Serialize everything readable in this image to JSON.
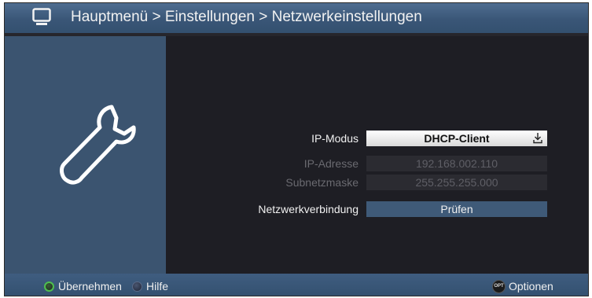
{
  "header": {
    "breadcrumb": "Hauptmenü > Einstellungen > Netzwerkeinstellungen"
  },
  "form": {
    "ip_mode_label": "IP-Modus",
    "ip_mode_value": "DHCP-Client",
    "ip_address_label": "IP-Adresse",
    "ip_address_value": "192.168.002.110",
    "subnet_label": "Subnetzmaske",
    "subnet_value": "255.255.255.000",
    "connection_label": "Netzwerkverbindung",
    "connection_button": "Prüfen"
  },
  "footer": {
    "green_label": "Übernehmen",
    "blue_label": "Hilfe",
    "opt_badge": "OPT",
    "options_label": "Optionen"
  },
  "colors": {
    "accent_blue": "#3b5470",
    "highlight_white": "#ffffff",
    "green_key": "#4fbf4f"
  }
}
